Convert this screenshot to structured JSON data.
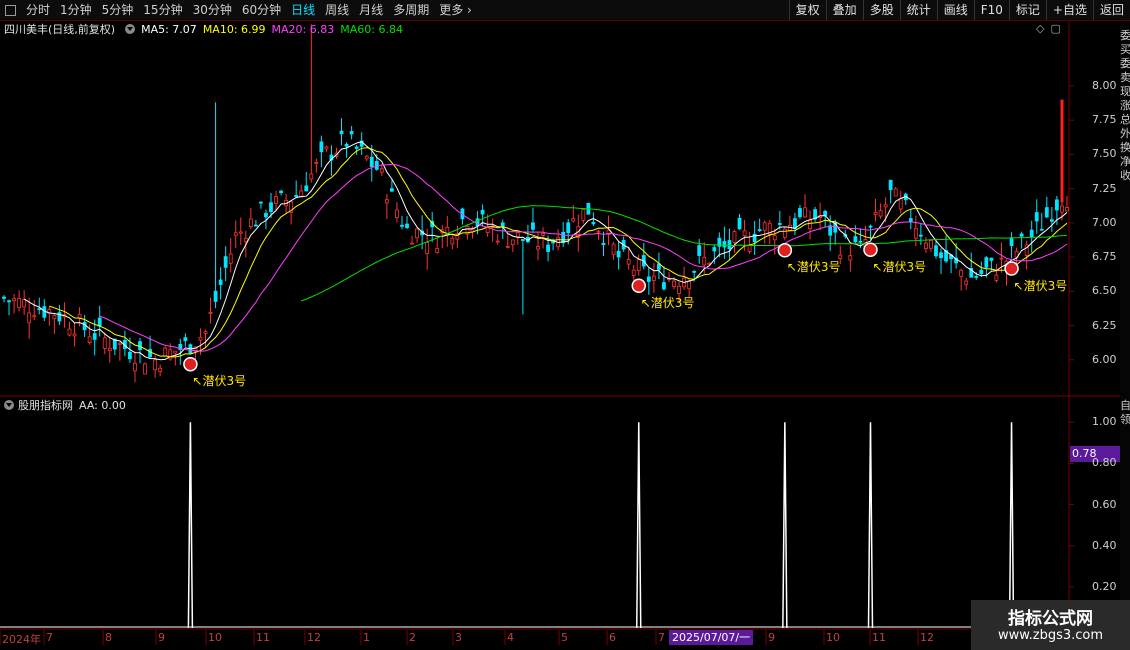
{
  "toolbar": {
    "periods": [
      "分时",
      "1分钟",
      "5分钟",
      "15分钟",
      "30分钟",
      "60分钟",
      "日线",
      "周线",
      "月线",
      "多周期",
      "更多"
    ],
    "active_period": "日线",
    "buttons": [
      "复权",
      "叠加",
      "多股",
      "统计",
      "画线",
      "F10",
      "标记",
      "+自选",
      "返回"
    ]
  },
  "header": {
    "stock_name": "四川美丰(日线,前复权)",
    "ma5": "MA5: 7.07",
    "ma10": "MA10: 6.99",
    "ma20": "MA20: 6.83",
    "ma60": "MA60: 6.84",
    "colors": {
      "ma5": "#ffffff",
      "ma10": "#ffff00",
      "ma20": "#ff40ff",
      "ma60": "#00e000"
    }
  },
  "indicator": {
    "name": "股朋指标网",
    "aa": "AA: 0.00",
    "current_tag": "0.78"
  },
  "signals": {
    "label": "潜伏3号",
    "arrow": "↖"
  },
  "price_axis": [
    "8.00",
    "7.75",
    "7.50",
    "7.25",
    "7.00",
    "6.75",
    "6.50",
    "6.25",
    "6.00"
  ],
  "indicator_axis": [
    "1.00",
    "0.80",
    "0.60",
    "0.40",
    "0.20"
  ],
  "x_axis": {
    "labels": [
      "2024年",
      "7",
      "8",
      "9",
      "10",
      "11",
      "12",
      "1",
      "2",
      "3",
      "4",
      "5",
      "6",
      "7",
      "9",
      "10",
      "11",
      "12"
    ],
    "cursor_date": "2025/07/07/一"
  },
  "side_panel_text": "委买委卖现涨总外换净收",
  "side_panel_text2": "自领",
  "watermark": {
    "title": "指标公式网",
    "url": "www.zbgs3.com"
  },
  "chart_data": {
    "type": "candlestick",
    "price_ylim": [
      5.75,
      8.35
    ],
    "indicator_ylim": [
      0,
      1.05
    ],
    "signal_indices": [
      37,
      126,
      155,
      172,
      200
    ],
    "close_start": 6.44,
    "close_end": 7.22,
    "high_max": 8.45,
    "low_min": 5.91,
    "ma_current": {
      "MA5": 7.07,
      "MA10": 6.99,
      "MA20": 6.83,
      "MA60": 6.84
    }
  }
}
